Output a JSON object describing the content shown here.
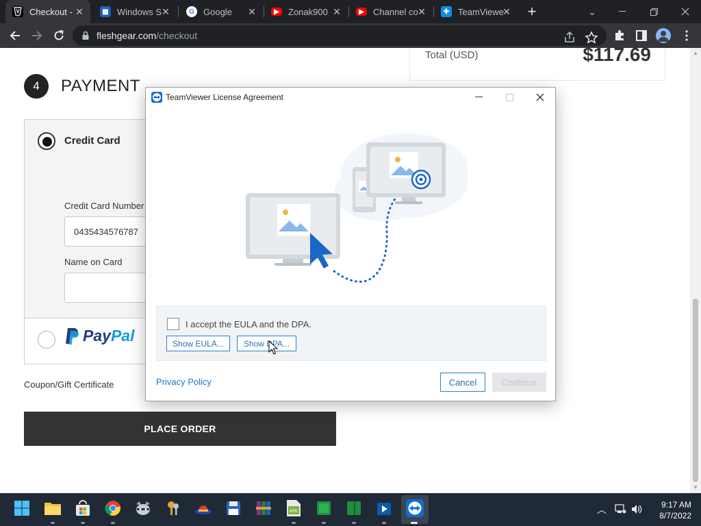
{
  "browser": {
    "tabs": [
      {
        "label": "Checkout -",
        "favicon": "fleshgear-icon",
        "active": true
      },
      {
        "label": "Windows S",
        "favicon": "windows-icon"
      },
      {
        "label": "Google",
        "favicon": "google-icon"
      },
      {
        "label": "Zonak900",
        "favicon": "youtube-icon"
      },
      {
        "label": "Channel co",
        "favicon": "youtube-icon"
      },
      {
        "label": "TeamViewe",
        "favicon": "teamviewer-icon"
      }
    ],
    "url_host": "fleshgear.com",
    "url_path": "/checkout"
  },
  "page": {
    "total_label": "Total (USD)",
    "total_value": "$117.69",
    "step_number": "4",
    "step_title": "PAYMENT",
    "credit_card_label": "Credit Card",
    "cc_number_label": "Credit Card Number",
    "cc_number_value": "0435434576787",
    "name_on_card_label": "Name on Card",
    "name_on_card_value": "",
    "paypal_pay": "Pay",
    "paypal_pal": "Pal",
    "coupon_label": "Coupon/Gift Certificate",
    "place_order": "PLACE ORDER"
  },
  "dialog": {
    "title": "TeamViewer License Agreement",
    "accept_text": "I accept the EULA and the DPA.",
    "accept_checked": false,
    "show_eula": "Show EULA...",
    "show_dpa": "Show DPA...",
    "privacy_policy": "Privacy Policy",
    "cancel": "Cancel",
    "continue": "Continue"
  },
  "taskbar": {
    "time": "9:17 AM",
    "date": "8/7/2022"
  },
  "colors": {
    "teamviewer_blue": "#0e6fd4",
    "dialog_link": "#1f74c8",
    "chrome_dark": "#202124",
    "place_order_bg": "#333333"
  }
}
